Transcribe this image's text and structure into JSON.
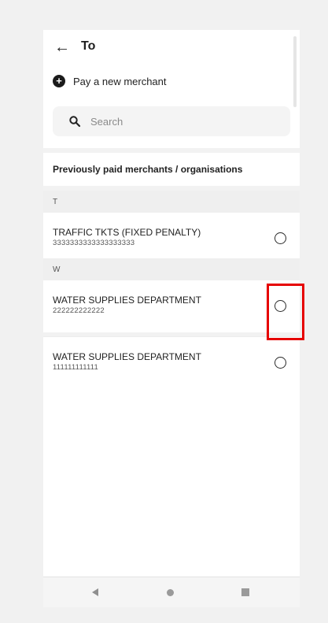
{
  "header": {
    "title": "To",
    "back_icon": "arrow-left-icon",
    "pay_new_label": "Pay a new merchant",
    "pay_new_icon": "plus-circle-icon"
  },
  "search": {
    "placeholder": "Search",
    "icon": "search-icon"
  },
  "list": {
    "heading": "Previously paid merchants / organisations",
    "sections": [
      {
        "letter": "T",
        "merchants": [
          {
            "name": "TRAFFIC TKTS (FIXED PENALTY)",
            "account": "3333333333333333333"
          }
        ]
      },
      {
        "letter": "W",
        "merchants": [
          {
            "name": "WATER SUPPLIES DEPARTMENT",
            "account": "222222222222"
          },
          {
            "name": "WATER SUPPLIES DEPARTMENT",
            "account": "111111111111"
          }
        ]
      }
    ]
  },
  "navbar": {
    "back_icon": "nav-back-icon",
    "home_icon": "nav-home-icon",
    "recents_icon": "nav-recents-icon"
  },
  "colors": {
    "highlight": "#e60000",
    "background": "#f1f1f1"
  }
}
